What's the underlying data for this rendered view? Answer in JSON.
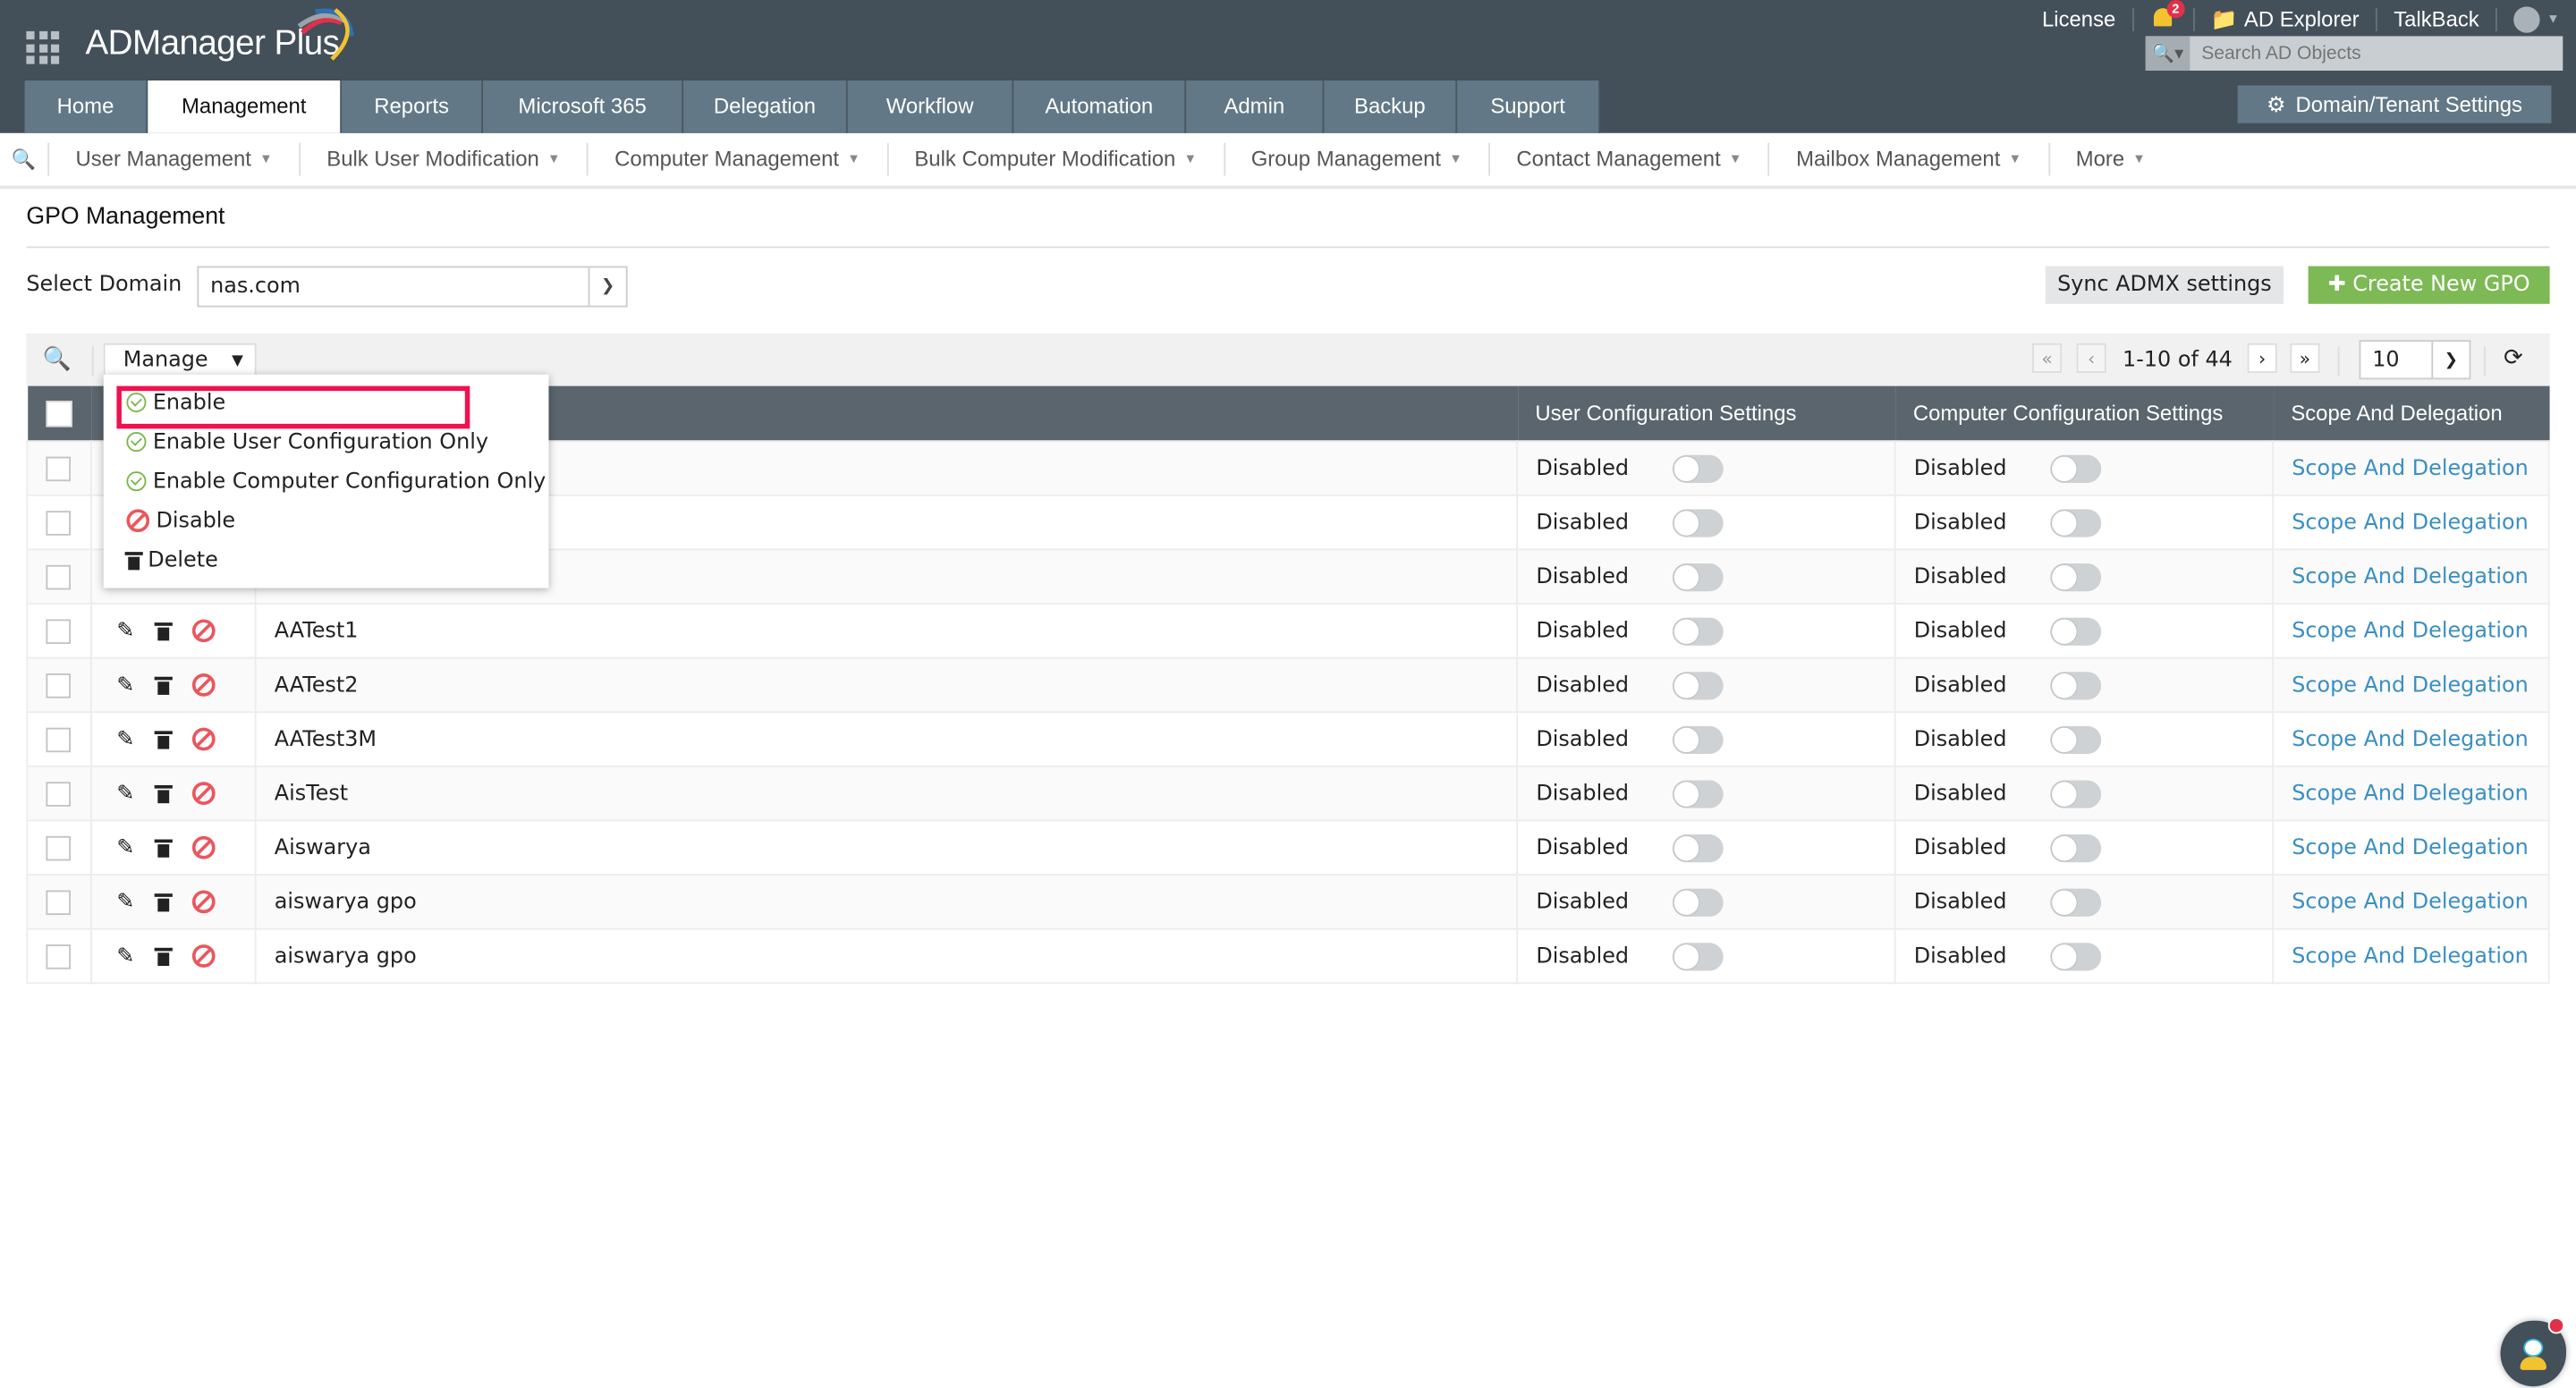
{
  "app": {
    "title": "ADManager Plus",
    "top_links": {
      "license": "License",
      "notifications_count": "2",
      "ad_explorer": "AD Explorer",
      "talkback": "TalkBack"
    },
    "search": {
      "placeholder": "Search AD Objects",
      "value": ""
    },
    "domain_settings_label": "Domain/Tenant Settings",
    "main_tabs": [
      {
        "label": "Home",
        "active": false
      },
      {
        "label": "Management",
        "active": true
      },
      {
        "label": "Reports",
        "active": false
      },
      {
        "label": "Microsoft 365",
        "active": false
      },
      {
        "label": "Delegation",
        "active": false
      },
      {
        "label": "Workflow",
        "active": false
      },
      {
        "label": "Automation",
        "active": false
      },
      {
        "label": "Admin",
        "active": false
      },
      {
        "label": "Backup",
        "active": false
      },
      {
        "label": "Support",
        "active": false
      }
    ],
    "sub_nav": [
      "User Management",
      "Bulk User Modification",
      "Computer Management",
      "Bulk Computer Modification",
      "Group Management",
      "Contact Management",
      "Mailbox Management",
      "More"
    ]
  },
  "page": {
    "title": "GPO Management",
    "select_domain_label": "Select Domain",
    "selected_domain": "nas.com",
    "sync_button": "Sync ADMX settings",
    "create_button": "Create New GPO",
    "toolbar": {
      "manage_label": "Manage",
      "pagination_text": "1-10 of 44",
      "page_size": "10"
    },
    "manage_menu": [
      {
        "label": "Enable",
        "icon": "check-circle-icon",
        "highlighted": true
      },
      {
        "label": "Enable User Configuration Only",
        "icon": "check-user-icon"
      },
      {
        "label": "Enable Computer Configuration Only",
        "icon": "check-computer-icon"
      },
      {
        "label": "Disable",
        "icon": "ban-icon"
      },
      {
        "label": "Delete",
        "icon": "trash-icon"
      }
    ],
    "table": {
      "columns": [
        "",
        "",
        "",
        "User Configuration Settings",
        "Computer Configuration Settings",
        "Scope And Delegation"
      ],
      "rows": [
        {
          "name": "",
          "user_config": "Disabled",
          "computer_config": "Disabled",
          "scope": "Scope And Delegation"
        },
        {
          "name": "",
          "user_config": "Disabled",
          "computer_config": "Disabled",
          "scope": "Scope And Delegation"
        },
        {
          "name": "",
          "user_config": "Disabled",
          "computer_config": "Disabled",
          "scope": "Scope And Delegation"
        },
        {
          "name": "AATest1",
          "user_config": "Disabled",
          "computer_config": "Disabled",
          "scope": "Scope And Delegation"
        },
        {
          "name": "AATest2",
          "user_config": "Disabled",
          "computer_config": "Disabled",
          "scope": "Scope And Delegation"
        },
        {
          "name": "AATest3M",
          "user_config": "Disabled",
          "computer_config": "Disabled",
          "scope": "Scope And Delegation"
        },
        {
          "name": "AisTest",
          "user_config": "Disabled",
          "computer_config": "Disabled",
          "scope": "Scope And Delegation"
        },
        {
          "name": "Aiswarya",
          "user_config": "Disabled",
          "computer_config": "Disabled",
          "scope": "Scope And Delegation"
        },
        {
          "name": "aiswarya gpo",
          "user_config": "Disabled",
          "computer_config": "Disabled",
          "scope": "Scope And Delegation"
        },
        {
          "name": "aiswarya gpo",
          "user_config": "Disabled",
          "computer_config": "Disabled",
          "scope": "Scope And Delegation"
        }
      ]
    }
  },
  "colors": {
    "topbar": "#434f59",
    "tab": "#627886",
    "table_header": "#5a656d",
    "create_button": "#7db955",
    "link": "#3b8fc2",
    "highlight": "#f0114f"
  }
}
